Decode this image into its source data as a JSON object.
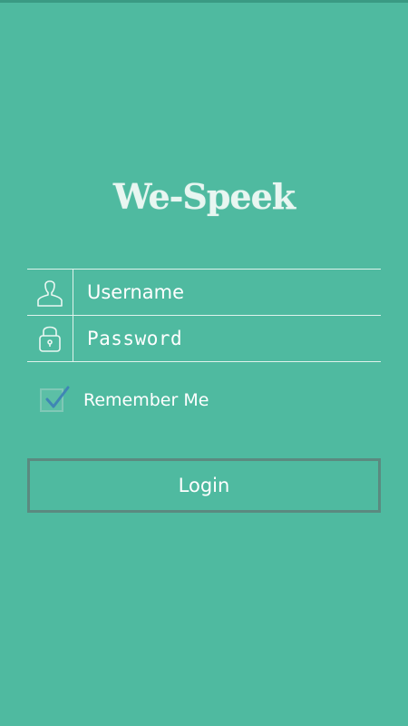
{
  "app": {
    "logo_text": "We-Speek"
  },
  "form": {
    "username_placeholder": "Username",
    "username_icon": "user-icon",
    "password_placeholder": "Password",
    "password_icon": "lock-icon"
  },
  "remember": {
    "label": "Remember Me",
    "checked": true
  },
  "actions": {
    "login_label": "Login"
  },
  "colors": {
    "background": "#4fbaa0",
    "line": "#dff3ec",
    "button_border": "#5b8a80",
    "check_mark": "#3f86b4"
  }
}
